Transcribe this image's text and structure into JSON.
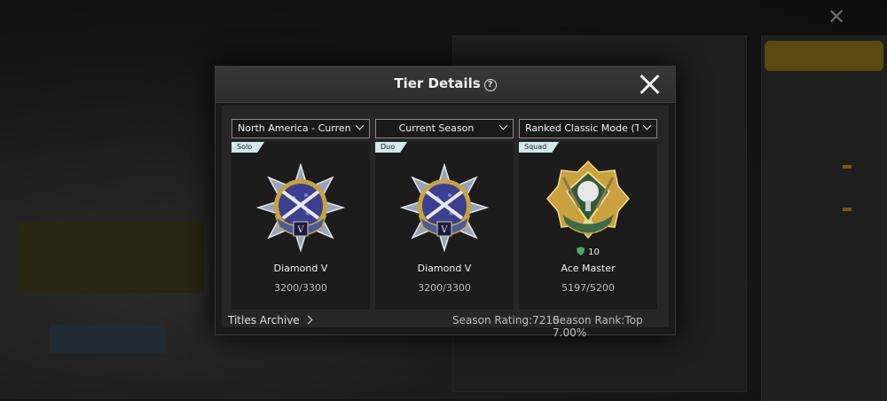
{
  "modal": {
    "title": "Tier Details"
  },
  "filters": {
    "region": "North America - Current",
    "season": "Current Season",
    "mode": "Ranked Classic Mode (TPP)"
  },
  "cards": [
    {
      "mode": "Solo",
      "tier": "Diamond V",
      "points": "3200/3300"
    },
    {
      "mode": "Duo",
      "tier": "Diamond V",
      "points": "3200/3300"
    },
    {
      "mode": "Squad",
      "tier": "Ace Master",
      "points": "5197/5200",
      "level": "10"
    }
  ],
  "footer": {
    "archive_label": "Titles Archive",
    "season_rating": "Season Rating:7210",
    "season_rank": "Season Rank:Top 7.00%"
  },
  "colors": {
    "diamond_badge": "#3b3f8f",
    "ace_badge": "#c9a13e",
    "mode_tag": "#cfe9ec"
  }
}
